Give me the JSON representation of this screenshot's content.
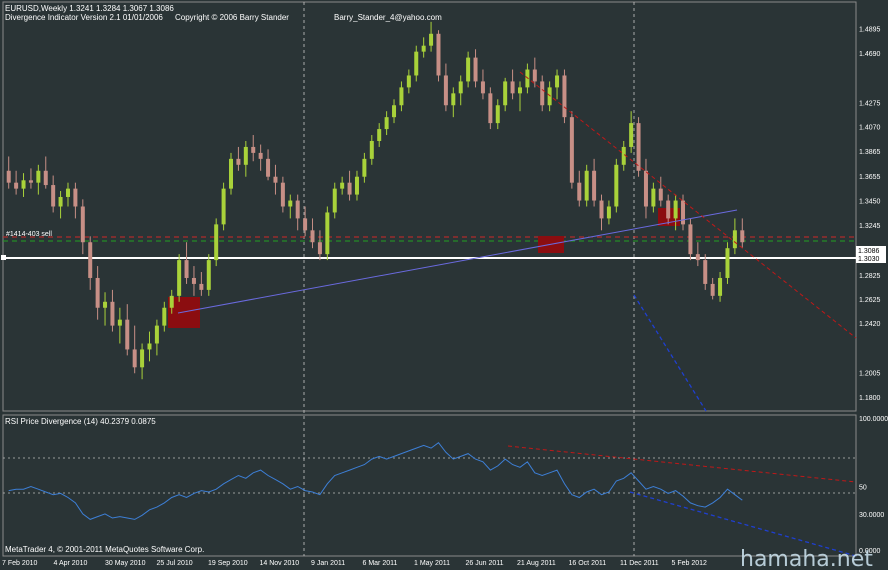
{
  "header": {
    "symbol_line": "EURUSD,Weekly  1.3241 1.3284 1.3067 1.3086",
    "indicator_line": "Divergence Indicator Version 2.1  01/01/2006",
    "copyright": "Copyright © 2006 Barry Stander",
    "email": "Barry_Stander_4@yahoo.com"
  },
  "level_label": "#1414-403 sell",
  "price_tags": {
    "current": "1.3086",
    "line": "1.3030"
  },
  "rsi_title": "RSI Price Divergence (14) 40.2379 0.0875",
  "footer": "MetaTrader 4, © 2001-2011 MetaQuotes Software Corp.",
  "watermark": "hamaha.net",
  "colors": {
    "bg": "#2a3436",
    "bull": "#a9d23a",
    "bear": "#c78f86",
    "rsi": "#3d7fd6",
    "trend_red": "#c01818",
    "trend_blue": "#1f3fd0",
    "box": "#8b0d10",
    "green_dash": "#22a022"
  },
  "chart_data": [
    {
      "type": "candlestick",
      "title": "EURUSD,Weekly",
      "ylim": [
        1.17,
        1.51
      ],
      "y_ticks": [
        1.4895,
        1.469,
        1.4275,
        1.407,
        1.3865,
        1.3655,
        1.345,
        1.3245,
        1.303,
        1.2825,
        1.2625,
        1.242,
        1.2005,
        1.18
      ],
      "x_labels": [
        "7 Feb 2010",
        "4 Apr 2010",
        "30 May 2010",
        "25 Jul 2010",
        "19 Sep 2010",
        "14 Nov 2010",
        "9 Jan 2011",
        "6 Mar 2011",
        "1 May 2011",
        "26 Jun 2011",
        "21 Aug 2011",
        "16 Oct 2011",
        "11 Dec 2011",
        "5 Feb 2012"
      ],
      "ohlc": [
        [
          1.37,
          1.382,
          1.355,
          1.36
        ],
        [
          1.36,
          1.37,
          1.35,
          1.355
        ],
        [
          1.355,
          1.368,
          1.348,
          1.362
        ],
        [
          1.362,
          1.372,
          1.355,
          1.36
        ],
        [
          1.36,
          1.375,
          1.35,
          1.37
        ],
        [
          1.37,
          1.382,
          1.355,
          1.358
        ],
        [
          1.358,
          1.366,
          1.335,
          1.34
        ],
        [
          1.34,
          1.353,
          1.33,
          1.348
        ],
        [
          1.348,
          1.36,
          1.34,
          1.355
        ],
        [
          1.355,
          1.36,
          1.33,
          1.34
        ],
        [
          1.34,
          1.346,
          1.3,
          1.31
        ],
        [
          1.31,
          1.315,
          1.27,
          1.28
        ],
        [
          1.28,
          1.29,
          1.245,
          1.255
        ],
        [
          1.255,
          1.268,
          1.24,
          1.26
        ],
        [
          1.26,
          1.27,
          1.235,
          1.24
        ],
        [
          1.24,
          1.255,
          1.225,
          1.245
        ],
        [
          1.245,
          1.258,
          1.215,
          1.22
        ],
        [
          1.22,
          1.24,
          1.2,
          1.205
        ],
        [
          1.205,
          1.225,
          1.195,
          1.22
        ],
        [
          1.22,
          1.235,
          1.21,
          1.225
        ],
        [
          1.225,
          1.245,
          1.215,
          1.24
        ],
        [
          1.24,
          1.26,
          1.235,
          1.255
        ],
        [
          1.255,
          1.27,
          1.25,
          1.265
        ],
        [
          1.265,
          1.3,
          1.26,
          1.295
        ],
        [
          1.295,
          1.31,
          1.275,
          1.28
        ],
        [
          1.28,
          1.29,
          1.265,
          1.275
        ],
        [
          1.275,
          1.285,
          1.265,
          1.27
        ],
        [
          1.27,
          1.3,
          1.265,
          1.295
        ],
        [
          1.295,
          1.33,
          1.29,
          1.325
        ],
        [
          1.325,
          1.36,
          1.32,
          1.355
        ],
        [
          1.355,
          1.385,
          1.35,
          1.38
        ],
        [
          1.38,
          1.39,
          1.37,
          1.375
        ],
        [
          1.375,
          1.395,
          1.365,
          1.39
        ],
        [
          1.39,
          1.4,
          1.378,
          1.385
        ],
        [
          1.385,
          1.392,
          1.37,
          1.38
        ],
        [
          1.38,
          1.388,
          1.362,
          1.365
        ],
        [
          1.365,
          1.375,
          1.35,
          1.36
        ],
        [
          1.36,
          1.365,
          1.335,
          1.34
        ],
        [
          1.34,
          1.35,
          1.33,
          1.345
        ],
        [
          1.345,
          1.35,
          1.32,
          1.33
        ],
        [
          1.33,
          1.34,
          1.315,
          1.32
        ],
        [
          1.32,
          1.33,
          1.305,
          1.31
        ],
        [
          1.31,
          1.32,
          1.295,
          1.3
        ],
        [
          1.3,
          1.34,
          1.295,
          1.335
        ],
        [
          1.335,
          1.36,
          1.33,
          1.355
        ],
        [
          1.355,
          1.365,
          1.35,
          1.36
        ],
        [
          1.36,
          1.37,
          1.345,
          1.35
        ],
        [
          1.35,
          1.37,
          1.345,
          1.365
        ],
        [
          1.365,
          1.385,
          1.36,
          1.38
        ],
        [
          1.38,
          1.4,
          1.375,
          1.395
        ],
        [
          1.395,
          1.41,
          1.39,
          1.405
        ],
        [
          1.405,
          1.42,
          1.4,
          1.415
        ],
        [
          1.415,
          1.43,
          1.41,
          1.425
        ],
        [
          1.425,
          1.445,
          1.42,
          1.44
        ],
        [
          1.44,
          1.455,
          1.435,
          1.45
        ],
        [
          1.45,
          1.475,
          1.445,
          1.47
        ],
        [
          1.47,
          1.482,
          1.465,
          1.475
        ],
        [
          1.475,
          1.495,
          1.47,
          1.485
        ],
        [
          1.485,
          1.488,
          1.445,
          1.45
        ],
        [
          1.45,
          1.46,
          1.42,
          1.425
        ],
        [
          1.425,
          1.44,
          1.415,
          1.435
        ],
        [
          1.435,
          1.45,
          1.425,
          1.445
        ],
        [
          1.445,
          1.47,
          1.44,
          1.465
        ],
        [
          1.465,
          1.472,
          1.44,
          1.445
        ],
        [
          1.445,
          1.455,
          1.43,
          1.435
        ],
        [
          1.435,
          1.44,
          1.405,
          1.41
        ],
        [
          1.41,
          1.43,
          1.405,
          1.425
        ],
        [
          1.425,
          1.448,
          1.42,
          1.445
        ],
        [
          1.445,
          1.455,
          1.43,
          1.435
        ],
        [
          1.435,
          1.445,
          1.42,
          1.44
        ],
        [
          1.44,
          1.46,
          1.435,
          1.455
        ],
        [
          1.455,
          1.465,
          1.44,
          1.445
        ],
        [
          1.445,
          1.45,
          1.42,
          1.425
        ],
        [
          1.425,
          1.445,
          1.42,
          1.44
        ],
        [
          1.44,
          1.455,
          1.43,
          1.45
        ],
        [
          1.45,
          1.455,
          1.41,
          1.415
        ],
        [
          1.415,
          1.42,
          1.355,
          1.36
        ],
        [
          1.36,
          1.37,
          1.34,
          1.345
        ],
        [
          1.345,
          1.375,
          1.34,
          1.37
        ],
        [
          1.37,
          1.38,
          1.34,
          1.345
        ],
        [
          1.345,
          1.35,
          1.32,
          1.33
        ],
        [
          1.33,
          1.345,
          1.325,
          1.34
        ],
        [
          1.34,
          1.38,
          1.335,
          1.375
        ],
        [
          1.375,
          1.395,
          1.37,
          1.39
        ],
        [
          1.39,
          1.42,
          1.385,
          1.41
        ],
        [
          1.41,
          1.415,
          1.365,
          1.37
        ],
        [
          1.37,
          1.38,
          1.33,
          1.34
        ],
        [
          1.34,
          1.36,
          1.335,
          1.355
        ],
        [
          1.355,
          1.365,
          1.34,
          1.345
        ],
        [
          1.345,
          1.35,
          1.325,
          1.33
        ],
        [
          1.33,
          1.35,
          1.32,
          1.345
        ],
        [
          1.345,
          1.35,
          1.32,
          1.325
        ],
        [
          1.325,
          1.33,
          1.295,
          1.3
        ],
        [
          1.3,
          1.31,
          1.29,
          1.295
        ],
        [
          1.295,
          1.3,
          1.27,
          1.275
        ],
        [
          1.275,
          1.28,
          1.262,
          1.265
        ],
        [
          1.265,
          1.285,
          1.26,
          1.28
        ],
        [
          1.28,
          1.31,
          1.275,
          1.305
        ],
        [
          1.305,
          1.33,
          1.3,
          1.32
        ],
        [
          1.32,
          1.33,
          1.305,
          1.31
        ]
      ],
      "series": [
        {
          "name": "#1414-403 sell",
          "values": [
            1.318
          ]
        },
        {
          "name": "1.3030",
          "values": [
            1.303
          ]
        }
      ]
    },
    {
      "type": "line",
      "title": "RSI Price Divergence (14) 40.2379 0.0875",
      "ylim": [
        0,
        100
      ],
      "y_ticks": [
        100,
        50,
        30,
        0
      ],
      "y_tick_labels": [
        "100.0000",
        "50",
        "30.0000",
        "0.0000"
      ],
      "values": [
        47,
        48,
        48,
        50,
        48,
        46,
        44,
        45,
        42,
        38,
        30,
        26,
        28,
        30,
        27,
        28,
        27,
        26,
        29,
        33,
        35,
        38,
        42,
        44,
        42,
        45,
        47,
        46,
        48,
        52,
        55,
        58,
        56,
        60,
        62,
        58,
        55,
        52,
        48,
        50,
        47,
        46,
        44,
        52,
        58,
        60,
        62,
        64,
        66,
        70,
        72,
        70,
        72,
        74,
        76,
        78,
        80,
        78,
        82,
        75,
        70,
        72,
        74,
        70,
        68,
        62,
        65,
        70,
        66,
        64,
        68,
        60,
        58,
        60,
        62,
        52,
        44,
        42,
        46,
        48,
        44,
        46,
        54,
        56,
        60,
        54,
        48,
        50,
        48,
        45,
        47,
        43,
        38,
        36,
        35,
        38,
        42,
        48,
        44,
        40
      ]
    }
  ]
}
